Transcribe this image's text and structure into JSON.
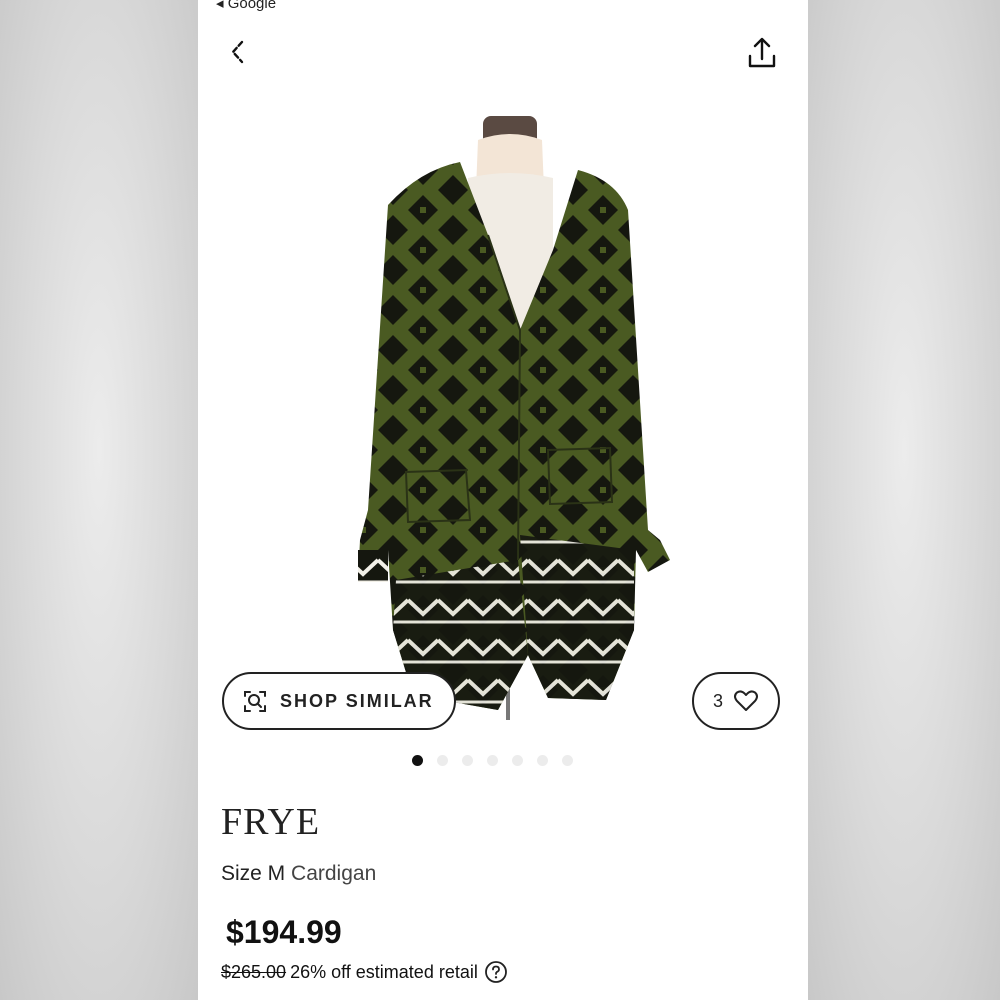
{
  "status_bar": {
    "back_label": "◂ Google"
  },
  "actions": {
    "shop_similar_label": "SHOP SIMILAR",
    "like_count": "3"
  },
  "carousel": {
    "total": 7,
    "active_index": 0
  },
  "product": {
    "brand": "FRYE",
    "size": "Size M",
    "category": "Cardigan",
    "price": "$194.99",
    "original_price": "$265.00",
    "discount_text": "26% off estimated retail"
  },
  "colors": {
    "cardigan_green": "#4a5a22",
    "cardigan_pattern": "#15170f",
    "accent_text": "#222222"
  },
  "icons": {
    "back": "chevron-left-icon",
    "share": "share-icon",
    "shop_similar": "visual-search-icon",
    "like": "heart-icon",
    "help": "question-circle-icon"
  }
}
